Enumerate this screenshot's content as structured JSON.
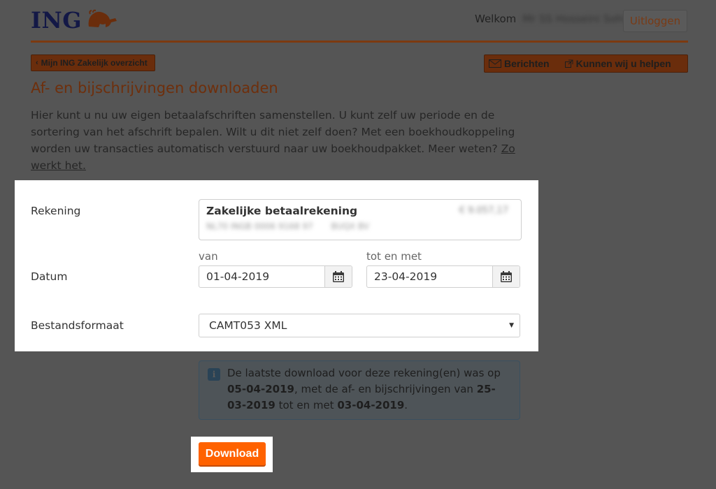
{
  "header": {
    "logo_text": "ING",
    "welcome": "Welkom",
    "user_name": "Mr SS Hosseini Sohi",
    "logout_label": "Uitloggen"
  },
  "nav": {
    "back_label": "Mijn ING Zakelijk overzicht",
    "messages_label": "Berichten",
    "help_label": "Kunnen wij u helpen"
  },
  "page": {
    "title": "Af- en bijschrijvingen downloaden",
    "intro_text": "Hier kunt u nu uw eigen betaalafschriften samenstellen. U kunt zelf uw periode en de sortering van het afschrift bepalen. Wilt u dit niet zelf doen? Met een boekhoudkoppeling worden uw transacties automatisch verstuurd naar uw boekhoudpakket. Meer weten?",
    "intro_link": "Zo werkt het."
  },
  "form": {
    "account_label": "Rekening",
    "account_name": "Zakelijke betaalrekening",
    "account_balance": "€ 9.057,17",
    "account_iban": "NL70 INGB 0006 9168 97",
    "account_holder": "BUQX BV",
    "date_label": "Datum",
    "from_label": "van",
    "from_value": "01-04-2019",
    "to_label": "tot en met",
    "to_value": "23-04-2019",
    "format_label": "Bestandsformaat",
    "format_value": "CAMT053 XML"
  },
  "info": {
    "text_1": "De laatste download voor deze rekening(en) was op ",
    "last_download": "05-04-2019",
    "text_2": ", met de af- en bijschrijvingen van ",
    "range_from": "25-03-2019",
    "text_3": " tot en met ",
    "range_to": "03-04-2019",
    "text_4": "."
  },
  "actions": {
    "download_label": "Download"
  },
  "colors": {
    "ing_orange": "#ff6200",
    "ing_navy": "#131846",
    "overlay": "#555555"
  }
}
